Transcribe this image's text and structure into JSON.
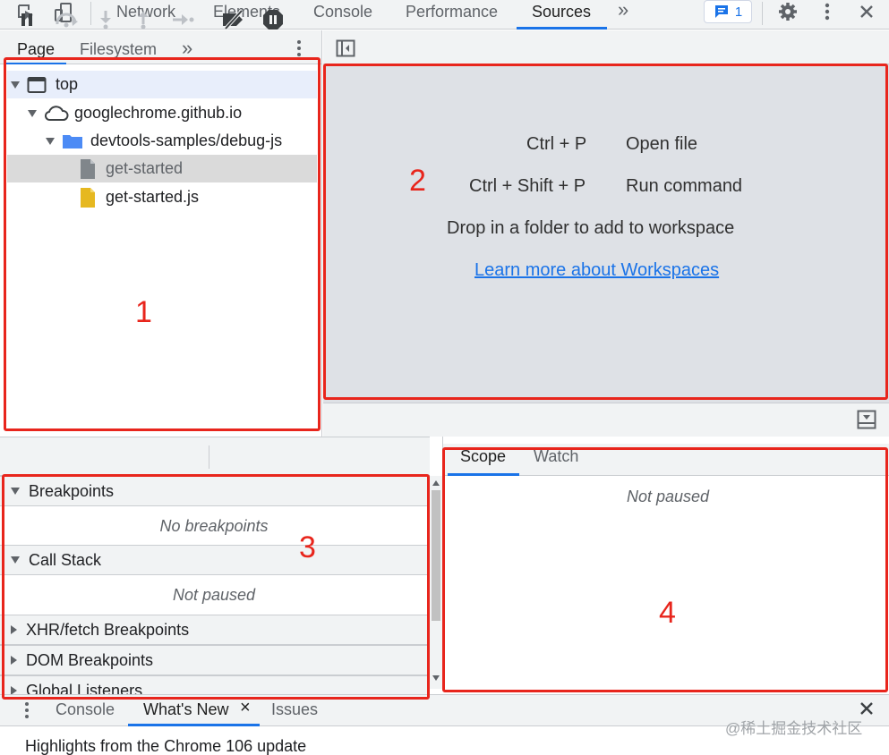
{
  "toolbar": {
    "tabs": [
      "Network",
      "Elements",
      "Console",
      "Performance",
      "Sources"
    ],
    "active_tab": "Sources",
    "more_tabs_glyph": "»",
    "issues_count": "1",
    "icons": [
      "inspect-element-icon",
      "device-toolbar-icon",
      "more-tabs-icon",
      "issues-icon",
      "settings-icon",
      "kebab-menu-icon",
      "close-icon"
    ]
  },
  "navigator": {
    "tabs": [
      "Page",
      "Filesystem"
    ],
    "active_tab": "Page",
    "more_glyph": "»",
    "tree": [
      {
        "label": "top",
        "icon": "frame-icon"
      },
      {
        "label": "googlechrome.github.io",
        "icon": "cloud-icon"
      },
      {
        "label": "devtools-samples/debug-js",
        "icon": "folder-icon"
      },
      {
        "label": "get-started",
        "icon": "document-icon"
      },
      {
        "label": "get-started.js",
        "icon": "js-file-icon"
      }
    ]
  },
  "editor": {
    "shortcuts": [
      {
        "keys": "Ctrl + P",
        "action": "Open file"
      },
      {
        "keys": "Ctrl + Shift + P",
        "action": "Run command"
      }
    ],
    "drop_text": "Drop in a folder to add to workspace",
    "learn_more": "Learn more about Workspaces"
  },
  "debugger": {
    "panes": [
      {
        "title": "Breakpoints",
        "expanded": true,
        "empty_text": "No breakpoints"
      },
      {
        "title": "Call Stack",
        "expanded": true,
        "empty_text": "Not paused"
      },
      {
        "title": "XHR/fetch Breakpoints",
        "expanded": false
      },
      {
        "title": "DOM Breakpoints",
        "expanded": false
      },
      {
        "title": "Global Listeners",
        "expanded": false
      }
    ],
    "scope_tabs": [
      "Scope",
      "Watch"
    ],
    "scope_active": "Scope",
    "scope_empty": "Not paused"
  },
  "drawer": {
    "tabs": [
      "Console",
      "What's New",
      "Issues"
    ],
    "active_tab": "What's New",
    "close_glyph": "×",
    "highlights": "Highlights from the Chrome 106 update"
  },
  "annotations": {
    "labels": [
      "1",
      "2",
      "3",
      "4"
    ],
    "color": "#e8251c"
  },
  "watermark": "@稀土掘金技术社区",
  "colors": {
    "accent": "#1a73e8",
    "editor_bg": "#dee1e6",
    "toolbar_bg": "#f1f3f4",
    "folder": "#4c8bf5",
    "js_file": "#e6b820"
  }
}
